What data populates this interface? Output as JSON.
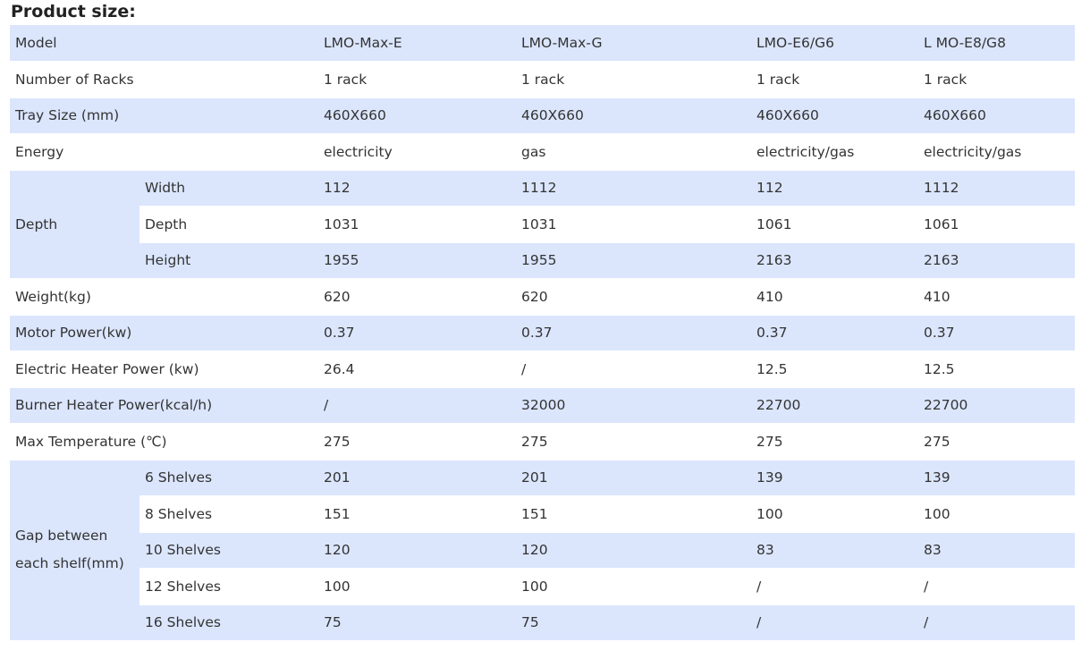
{
  "heading": "Product size:",
  "header": {
    "label": "Model",
    "models": [
      "LMO-Max-E",
      "LMO-Max-G",
      "LMO-E6/G6",
      "L MO-E8/G8"
    ]
  },
  "simple_rows_top": [
    {
      "label": "Number of Racks",
      "values": [
        "1 rack",
        "1 rack",
        "1 rack",
        "1 rack"
      ]
    },
    {
      "label": "Tray Size (mm)",
      "values": [
        "460X660",
        "460X660",
        "460X660",
        "460X660"
      ]
    },
    {
      "label": "Energy",
      "values": [
        "electricity",
        "gas",
        "electricity/gas",
        "electricity/gas"
      ]
    }
  ],
  "depth_group": {
    "label": "Depth",
    "rows": [
      {
        "label": "Width",
        "values": [
          "112",
          "1112",
          "112",
          "1112"
        ]
      },
      {
        "label": "Depth",
        "values": [
          "1031",
          "1031",
          "1061",
          "1061"
        ]
      },
      {
        "label": "Height",
        "values": [
          "1955",
          "1955",
          "2163",
          "2163"
        ]
      }
    ]
  },
  "simple_rows_mid": [
    {
      "label": "Weight(kg)",
      "values": [
        "620",
        "620",
        "410",
        "410"
      ]
    },
    {
      "label": "Motor Power(kw)",
      "values": [
        "0.37",
        "0.37",
        "0.37",
        "0.37"
      ]
    },
    {
      "label": "Electric Heater Power (kw)",
      "values": [
        "26.4",
        "/",
        "12.5",
        "12.5"
      ]
    },
    {
      "label": "Burner Heater Power(kcal/h)",
      "values": [
        "/",
        "32000",
        "22700",
        "22700"
      ]
    },
    {
      "label": "Max Temperature (℃)",
      "values": [
        "275",
        "275",
        "275",
        "275"
      ]
    }
  ],
  "gap_group": {
    "label": "Gap between each shelf(mm)",
    "rows": [
      {
        "label": "6 Shelves",
        "values": [
          "201",
          "201",
          "139",
          "139"
        ]
      },
      {
        "label": "8 Shelves",
        "values": [
          "151",
          "151",
          "100",
          "100"
        ]
      },
      {
        "label": "10 Shelves",
        "values": [
          "120",
          "120",
          "83",
          "83"
        ]
      },
      {
        "label": "12 Shelves",
        "values": [
          "100",
          "100",
          "/",
          "/"
        ]
      },
      {
        "label": "16 Shelves",
        "values": [
          "75",
          "75",
          "/",
          "/"
        ]
      }
    ]
  }
}
